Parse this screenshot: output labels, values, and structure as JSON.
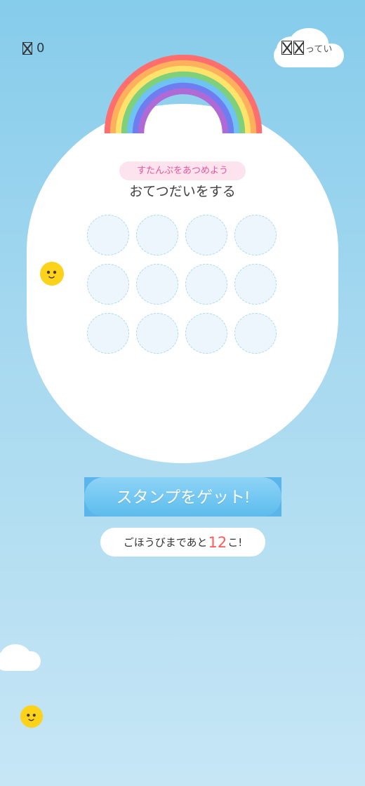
{
  "header": {
    "left_count": "0",
    "right_text": "ってい"
  },
  "card": {
    "badge": "すたんぷをあつめよう",
    "title": "おてつだいをする",
    "stamp_slots": 12,
    "stamps_collected": 0
  },
  "actions": {
    "get_stamp_label": "スタンプをゲット!",
    "remaining_prefix": "ごほうびまであと",
    "remaining_count": "12",
    "remaining_suffix": "こ!"
  },
  "colors": {
    "background_top": "#86cceb",
    "background_bottom": "#c6e6f5",
    "badge_bg": "#fde3ee",
    "badge_text": "#e8559a",
    "button": "#6fc6f1",
    "remaining_number": "#ff5b5b",
    "rainbow": [
      "#ff6e6e",
      "#ffb05c",
      "#ffe36a",
      "#7ed07a",
      "#6ec3f4",
      "#6f7df0",
      "#b06ad6"
    ]
  },
  "icons": {
    "left": "missing-glyph-icon",
    "right": "missing-glyph-icon",
    "mascot": "chick-face-icon",
    "decoration": "rainbow-icon"
  }
}
